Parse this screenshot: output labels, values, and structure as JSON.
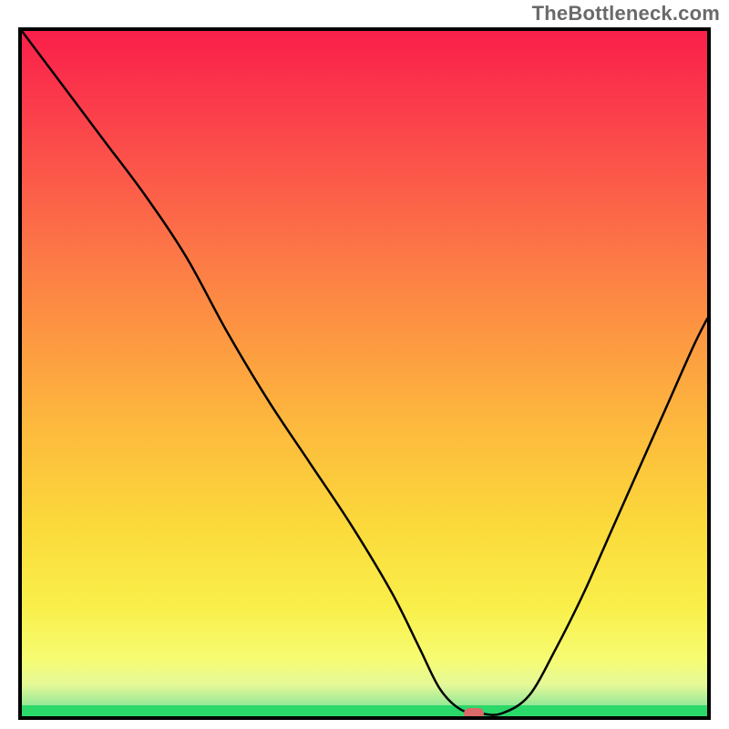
{
  "watermark": "TheBottleneck.com",
  "chart_data": {
    "type": "line",
    "title": "",
    "xlabel": "",
    "ylabel": "",
    "xlim": [
      0,
      100
    ],
    "ylim": [
      0,
      100
    ],
    "grid": false,
    "legend": false,
    "background_gradient_bands": [
      {
        "name": "green-bottom",
        "color": "#2bd86a"
      },
      {
        "name": "yellow-green-fade",
        "color": "#d7f5aa"
      },
      {
        "name": "yellow",
        "color": "#f9ef4a"
      },
      {
        "name": "orange",
        "color": "#fd9642"
      },
      {
        "name": "red-top",
        "color": "#fa1f4a"
      }
    ],
    "series": [
      {
        "name": "bottleneck-curve",
        "x": [
          0,
          6,
          12,
          18,
          24,
          30,
          36,
          42,
          48,
          54,
          58,
          61,
          64,
          67,
          70,
          74,
          78,
          82,
          86,
          90,
          94,
          98,
          100
        ],
        "y": [
          100,
          92,
          84,
          76,
          67,
          56,
          46,
          37,
          28,
          18,
          10,
          4,
          1,
          0.4,
          0.4,
          3,
          10,
          18,
          27,
          36,
          45,
          54,
          58
        ]
      }
    ],
    "marker": {
      "x": 66,
      "y": 0.4,
      "color": "#d96a6a",
      "shape": "rounded-rect"
    }
  }
}
